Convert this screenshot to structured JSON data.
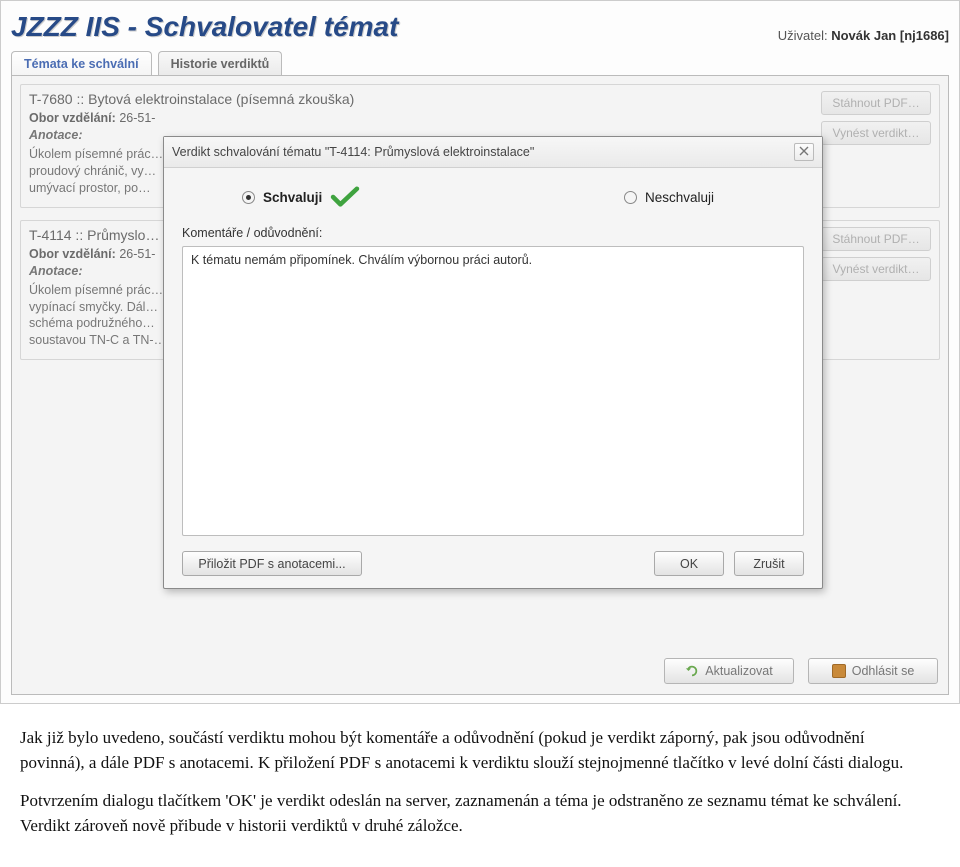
{
  "header": {
    "title": "JZZZ IIS - Schvalovatel témat",
    "user_prefix": "Uživatel: ",
    "user_name": "Novák Jan [nj1686]"
  },
  "tabs": [
    {
      "label": "Témata ke schvální",
      "active": true
    },
    {
      "label": "Historie verdiktů",
      "active": false
    }
  ],
  "topics": [
    {
      "id": "topic-t7680",
      "title": "T-7680 :: Bytová elektroinstalace (písemná zkouška)",
      "obor_label": "Obor vzdělání:",
      "obor_value": "26-51-",
      "anotace_label": "Anotace:",
      "desc": "Úkolem písemné prác…\nproudový chránič, vy…\numývací prostor, po…",
      "actions": {
        "pdf": "Stáhnout PDF…",
        "verdikt": "Vynést verdikt…"
      }
    },
    {
      "id": "topic-t4114",
      "title": "T-4114 :: Průmyslo…",
      "obor_label": "Obor vzdělání:",
      "obor_value": "26-51-",
      "anotace_label": "Anotace:",
      "desc": "Úkolem písemné prác…\nvypínací smyčky. Dál…\nschéma podružného…\nsoustavou TN-C a TN-…",
      "actions": {
        "pdf": "Stáhnout PDF…",
        "verdikt": "Vynést verdikt…"
      }
    }
  ],
  "footer": {
    "refresh": "Aktualizovat",
    "logout": "Odhlásit se"
  },
  "dialog": {
    "title": "Verdikt schvalování tématu \"T-4114: Průmyslová elektroinstalace\"",
    "option_approve": "Schvaluji",
    "option_reject": "Neschvaluji",
    "comment_label": "Komentáře / odůvodnění:",
    "comment_value": "K tématu nemám připomínek. Chválím výbornou práci autorů.",
    "btn_attach": "Přiložit PDF s anotacemi...",
    "btn_ok": "OK",
    "btn_cancel": "Zrušit"
  },
  "caption": {
    "p1": "Jak již bylo uvedeno, součástí verdiktu mohou být komentáře a odůvodnění (pokud je verdikt záporný, pak jsou odůvodnění povinná), a dále PDF s anotacemi. K přiložení PDF s anotacemi k verdiktu slouží stejnojmenné tlačítko v levé dolní části dialogu.",
    "p2": "Potvrzením dialogu tlačítkem 'OK' je verdikt odeslán na server, zaznamenán a téma je odstraněno ze seznamu témat ke schválení. Verdikt zároveň nově přibude v historii verdiktů v druhé záložce."
  }
}
